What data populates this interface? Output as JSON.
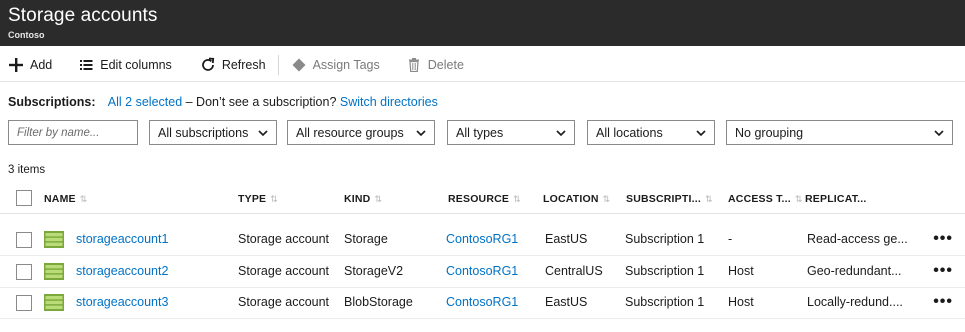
{
  "header": {
    "title": "Storage accounts",
    "subtitle": "Contoso"
  },
  "toolbar": {
    "add_label": "Add",
    "edit_columns_label": "Edit columns",
    "refresh_label": "Refresh",
    "assign_tags_label": "Assign Tags",
    "delete_label": "Delete"
  },
  "subscriptions": {
    "label": "Subscriptions:",
    "selected": "All 2 selected",
    "middle_text": " – Don’t see a subscription? ",
    "switch_link": "Switch directories"
  },
  "filters": {
    "name_placeholder": "Filter by name...",
    "subscriptions": "All subscriptions",
    "resource_groups": "All resource groups",
    "types": "All types",
    "locations": "All locations",
    "grouping": "No grouping"
  },
  "item_count": "3 items",
  "table": {
    "columns": [
      "NAME",
      "TYPE",
      "KIND",
      "RESOURCE",
      "LOCATION",
      "SUBSCRIPTI...",
      "ACCESS T...",
      "REPLICAT..."
    ],
    "rows": [
      {
        "name": "storageaccount1",
        "type": "Storage account",
        "kind": "Storage",
        "resource": "ContosoRG1",
        "location": "EastUS",
        "subscription": "Subscription 1",
        "access": "-",
        "replication": "Read-access ge...",
        "more": "•••"
      },
      {
        "name": "storageaccount2",
        "type": "Storage account",
        "kind": "StorageV2",
        "resource": "ContosoRG1",
        "location": "CentralUS",
        "subscription": "Subscription 1",
        "access": "Host",
        "replication": "Geo-redundant...",
        "more": "•••"
      },
      {
        "name": "storageaccount3",
        "type": "Storage account",
        "kind": "BlobStorage",
        "resource": "ContosoRG1",
        "location": "EastUS",
        "subscription": "Subscription 1",
        "access": "Host",
        "replication": "Locally-redund....",
        "more": "•••"
      }
    ]
  },
  "colors": {
    "titlebar": "#2b2b2b",
    "link": "#0072c6",
    "storage_icon": "#8cbd3f"
  },
  "icons": [
    "plus-icon",
    "list-icon",
    "refresh-icon",
    "tag-icon",
    "trash-icon",
    "chevron-down-icon",
    "storage-account-icon",
    "more-icon"
  ]
}
